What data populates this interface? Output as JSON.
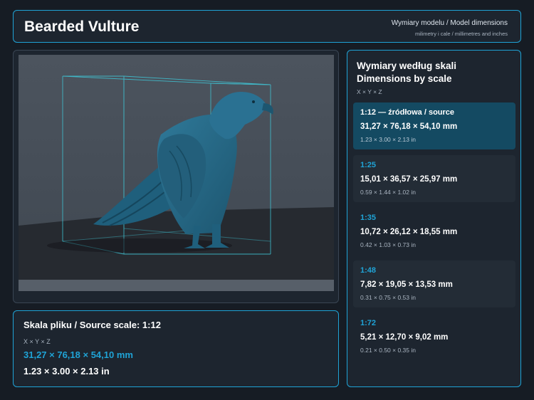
{
  "header": {
    "title": "Bearded Vulture",
    "subtitle": "Wymiary modelu / Model dimensions",
    "units_note": "milimetry i cale / millimetres and inches"
  },
  "source": {
    "title": "Skala pliku / Source scale: 1:12",
    "axis_label": "X × Y × Z",
    "mm": "31,27 × 76,18 × 54,10 mm",
    "inches": "1.23 × 3.00 × 2.13 in"
  },
  "scales_panel": {
    "title": "Wymiary według skali Dimensions by scale",
    "axis_label": "X × Y × Z",
    "items": [
      {
        "scale": "1:12  —  źródłowa / source",
        "mm": "31,27 × 76,18 × 54,10 mm",
        "inches": "1.23 × 3.00 × 2.13 in",
        "state": "active"
      },
      {
        "scale": "1:25",
        "mm": "15,01 × 36,57 × 25,97 mm",
        "inches": "0.59 × 1.44 × 1.02 in",
        "state": "dim"
      },
      {
        "scale": "1:35",
        "mm": "10,72 × 26,12 × 18,55 mm",
        "inches": "0.42 × 1.03 × 0.73 in",
        "state": "plain"
      },
      {
        "scale": "1:48",
        "mm": "7,82 × 19,05 × 13,53 mm",
        "inches": "0.31 × 0.75 × 0.53 in",
        "state": "dim"
      },
      {
        "scale": "1:72",
        "mm": "5,21 × 12,70 × 9,02 mm",
        "inches": "0.21 × 0.50 × 0.35 in",
        "state": "plain"
      }
    ]
  },
  "colors": {
    "accent": "#1fa3d6",
    "background": "#161c24",
    "panel": "#1d252f",
    "active_card": "#144a62",
    "model": "#2b6d8c",
    "bounding_box": "#3fc6d6"
  }
}
